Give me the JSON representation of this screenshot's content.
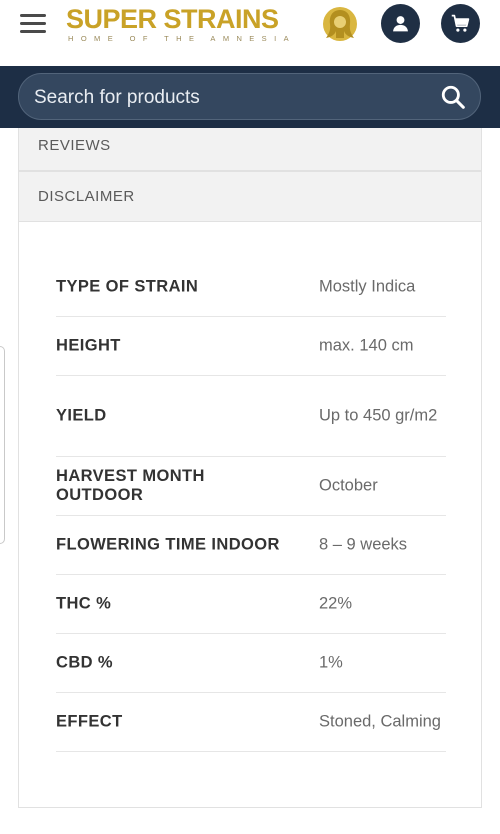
{
  "header": {
    "logo_text": "SUPER STRAINS",
    "logo_tagline": "HOME OF THE AMNESIA",
    "menu_icon": "hamburger-menu-icon",
    "account_icon": "user-icon",
    "cart_icon": "cart-icon",
    "brand_color": "#c9a227",
    "button_color": "#1f2f44"
  },
  "search": {
    "placeholder": "Search for products",
    "icon": "search-icon",
    "bar_color": "#1d2e45"
  },
  "accordion": {
    "reviews_label": "REVIEWS",
    "disclaimer_label": "DISCLAIMER"
  },
  "specs": [
    {
      "key": "TYPE OF STRAIN",
      "value": "Mostly Indica"
    },
    {
      "key": "HEIGHT",
      "value": "max. 140 cm"
    },
    {
      "key": "YIELD",
      "value": "Up to 450 gr/m2"
    },
    {
      "key": "HARVEST MONTH OUTDOOR",
      "value": "October"
    },
    {
      "key": "FLOWERING TIME INDOOR",
      "value": "8 – 9 weeks"
    },
    {
      "key": "THC %",
      "value": "22%"
    },
    {
      "key": "CBD %",
      "value": "1%"
    },
    {
      "key": "EFFECT",
      "value": "Stoned, Calming"
    }
  ]
}
